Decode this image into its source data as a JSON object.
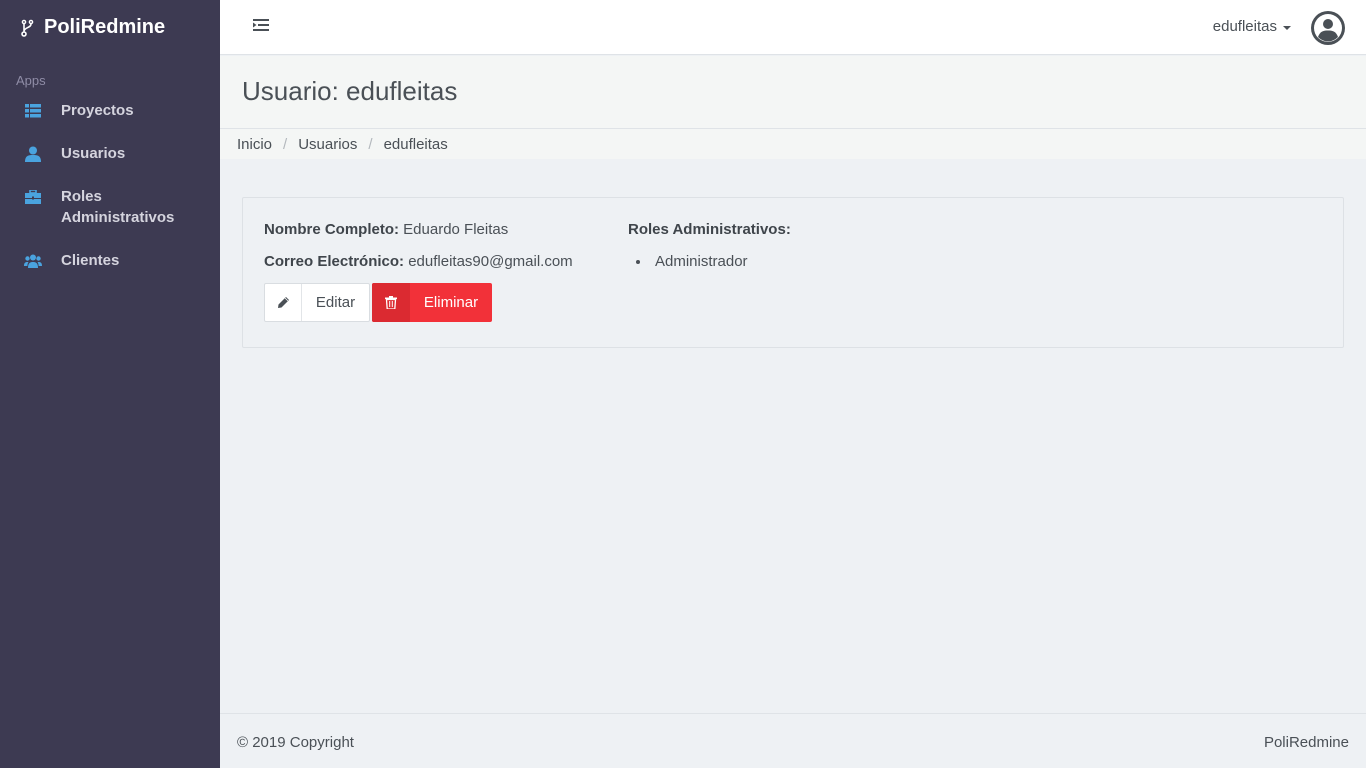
{
  "app": {
    "brand": "PoliRedmine"
  },
  "sidebar": {
    "section_label": "Apps",
    "items": [
      {
        "label": "Proyectos",
        "icon": "list-icon"
      },
      {
        "label": "Usuarios",
        "icon": "user-icon"
      },
      {
        "label": "Roles Administrativos",
        "icon": "briefcase-icon"
      },
      {
        "label": "Clientes",
        "icon": "users-icon"
      }
    ]
  },
  "topbar": {
    "username": "edufleitas"
  },
  "page": {
    "title": "Usuario: edufleitas",
    "breadcrumb": [
      "Inicio",
      "Usuarios",
      "edufleitas"
    ]
  },
  "user": {
    "name_label": "Nombre Completo:",
    "name_value": "Eduardo Fleitas",
    "email_label": "Correo Electrónico:",
    "email_value": "edufleitas90@gmail.com",
    "roles_label": "Roles Administrativos:",
    "roles": [
      "Administrador"
    ]
  },
  "actions": {
    "edit_label": "Editar",
    "delete_label": "Eliminar"
  },
  "footer": {
    "copyright": "© 2019 Copyright",
    "brand": "PoliRedmine"
  },
  "colors": {
    "sidebar_bg": "#3d3a52",
    "accent_icon": "#4aa3df",
    "danger": "#f23139"
  }
}
